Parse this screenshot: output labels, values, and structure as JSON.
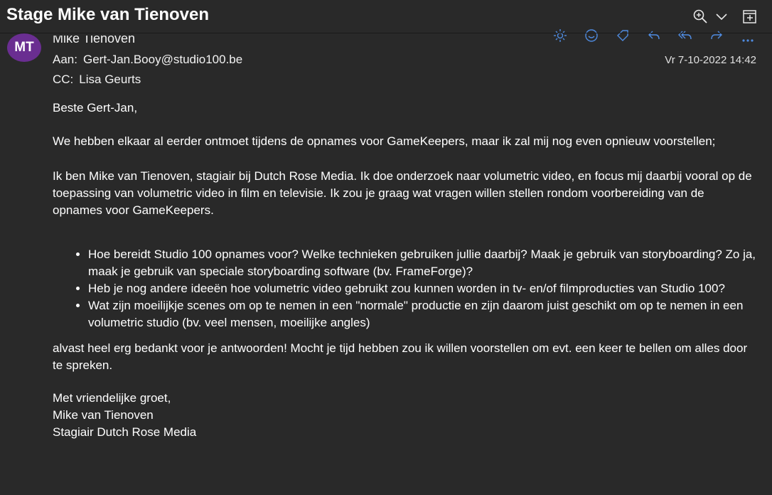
{
  "window": {
    "subject": "Stage Mike van Tienoven"
  },
  "message": {
    "avatar_initials": "MT",
    "sender": "Mike Tienoven",
    "to_label": "Aan:",
    "to": "Gert-Jan.Booy@studio100.be",
    "cc_label": "CC:",
    "cc": "Lisa Geurts",
    "date": "Vr 7-10-2022 14:42"
  },
  "body": {
    "greeting": "Beste Gert-Jan,",
    "para1": "We hebben elkaar al eerder ontmoet tijdens de opnames voor GameKeepers, maar ik zal mij nog even opnieuw voorstellen;",
    "para2": "Ik ben Mike van Tienoven, stagiair bij Dutch Rose Media. Ik doe onderzoek naar volumetric video, en focus mij daarbij vooral op de toepassing van volumetric video in film en televisie. Ik zou je graag wat vragen willen stellen rondom voorbereiding van de opnames voor GameKeepers.",
    "bullets": [
      "Hoe bereidt Studio 100 opnames voor? Welke technieken gebruiken jullie daarbij? Maak je gebruik van storyboarding? Zo ja, maak je gebruik van speciale storyboarding software (bv. FrameForge)?",
      "Heb je nog andere ideeën hoe volumetric video gebruikt zou kunnen worden in tv- en/of filmproducties van Studio 100?",
      "Wat zijn moeilijkje scenes om op te nemen in een \"normale\" productie en zijn daarom juist geschikt om op te nemen in een volumetric studio (bv. veel mensen, moeilijke angles)"
    ],
    "closing": "alvast heel erg bedankt voor je antwoorden! Mocht je tijd hebben zou ik willen voorstellen om evt. een keer te bellen om alles door te spreken.",
    "signoff": "Met vriendelijke groet,",
    "sig_name": "Mike van Tienoven",
    "sig_title": "Stagiair Dutch Rose Media"
  },
  "icons": {
    "zoom": "zoom-icon",
    "dropdown": "chevron-down-icon",
    "popout": "open-in-new-window-icon",
    "actions": [
      "sun-icon",
      "smiley-icon",
      "tag-icon",
      "reply-icon",
      "reply-all-icon",
      "forward-icon",
      "more-icon"
    ]
  },
  "colors": {
    "background": "#292929",
    "avatar": "#6a2e91",
    "action_icons": "#4f8be0"
  }
}
